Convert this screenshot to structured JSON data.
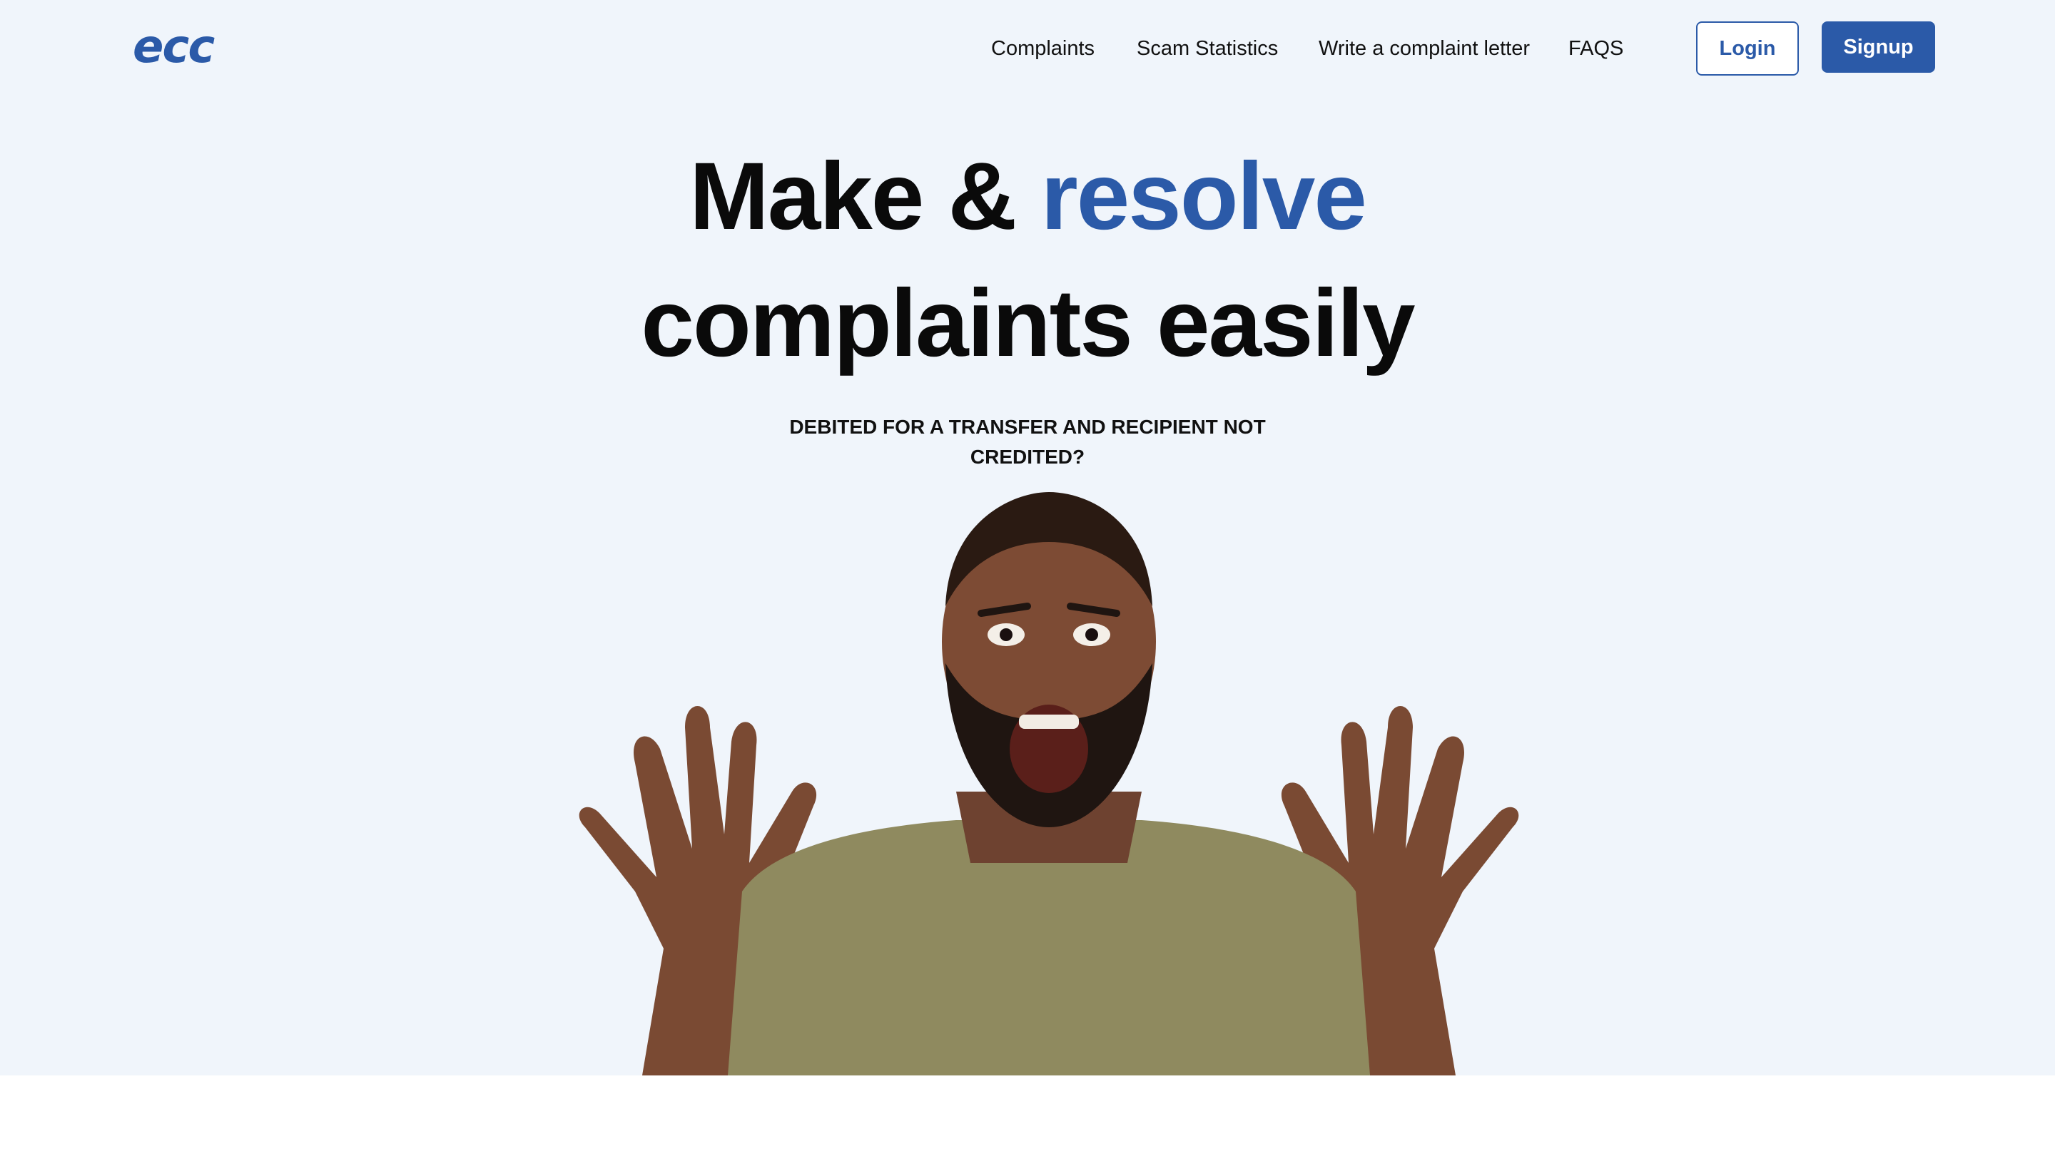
{
  "header": {
    "logo": "ecc",
    "nav": [
      "Complaints",
      "Scam Statistics",
      "Write a complaint letter",
      "FAQS"
    ],
    "login_label": "Login",
    "signup_label": "Signup"
  },
  "hero": {
    "headline_part1": "Make & ",
    "headline_accent": "resolve",
    "headline_line2": "complaints easily",
    "subheading": "DEBITED FOR A TRANSFER AND RECIPIENT NOT CREDITED?",
    "image": "shocked-man-photo"
  },
  "colors": {
    "brand": "#2b5aa8",
    "hero_background": "#f0f5fb",
    "text": "#0a0a0a"
  }
}
